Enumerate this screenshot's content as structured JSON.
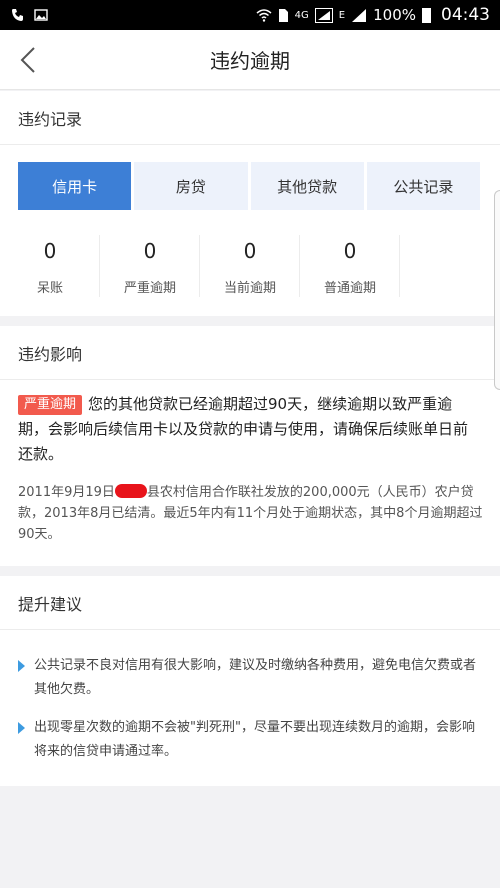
{
  "status_bar": {
    "signal_label": "4G",
    "mobile_label": "E",
    "battery": "100%",
    "time": "04:43"
  },
  "nav": {
    "title": "违约逾期"
  },
  "record": {
    "heading": "违约记录",
    "tabs": [
      {
        "label": "信用卡",
        "active": true
      },
      {
        "label": "房贷",
        "active": false
      },
      {
        "label": "其他贷款",
        "active": false
      },
      {
        "label": "公共记录",
        "active": false
      }
    ],
    "stats": [
      {
        "value": "0",
        "label": "呆账"
      },
      {
        "value": "0",
        "label": "严重逾期"
      },
      {
        "value": "0",
        "label": "当前逾期"
      },
      {
        "value": "0",
        "label": "普通逾期"
      }
    ]
  },
  "impact": {
    "heading": "违约影响",
    "badge": "严重逾期",
    "message": "您的其他贷款已经逾期超过90天，继续逾期以致严重逾期，会影响后续信用卡以及贷款的申请与使用，请确保后续账单日前还款。",
    "detail_before": "2011年9月19日",
    "detail_after": "县农村信用合作联社发放的200,000元（人民币）农户贷款，2013年8月已结清。最近5年内有11个月处于逾期状态，其中8个月逾期超过90天。"
  },
  "advice": {
    "heading": "提升建议",
    "items": [
      "公共记录不良对信用有很大影响，建议及时缴纳各种费用，避免电信欠费或者其他欠费。",
      "出现零星次数的逾期不会被\"判死刑\"，尽量不要出现连续数月的逾期，会影响将来的信贷申请通过率。"
    ]
  },
  "colors": {
    "accent": "#3d7fd6",
    "tab_bg": "#edf2fb",
    "badge": "#f25a4d",
    "bullet": "#3d9be0"
  }
}
